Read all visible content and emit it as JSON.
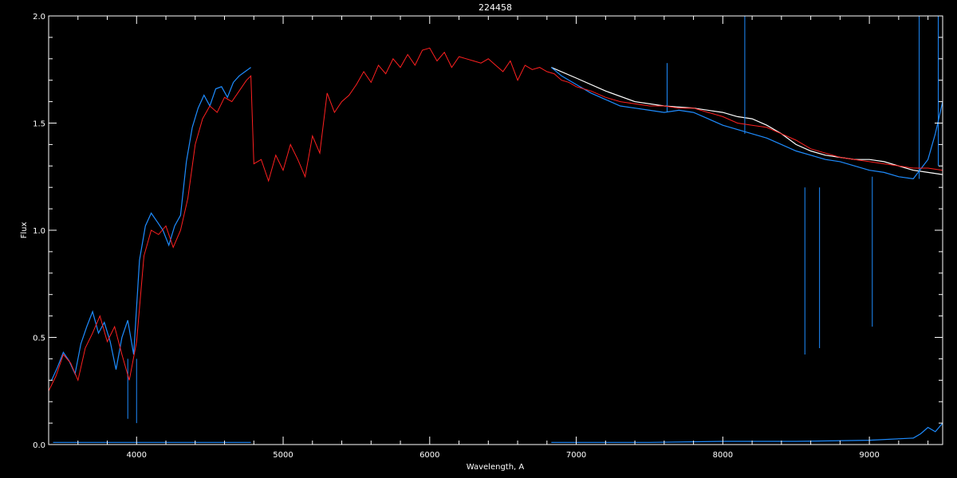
{
  "chart_data": {
    "type": "line",
    "title": "224458",
    "xlabel": "Wavelength, A",
    "ylabel": "Flux",
    "xlim": [
      3400,
      9500
    ],
    "ylim": [
      0.0,
      2.0
    ],
    "x_ticks": [
      4000,
      5000,
      6000,
      7000,
      8000,
      9000
    ],
    "x_tick_labels": [
      "4000",
      "5000",
      "6000",
      "7000",
      "8000",
      "9000"
    ],
    "y_ticks": [
      0.0,
      0.5,
      1.0,
      1.5,
      2.0
    ],
    "y_tick_labels": [
      "0.0",
      "0.5",
      "1.0",
      "1.5",
      "2.0"
    ],
    "grid": false,
    "colors": {
      "background": "#000000",
      "axes": "#ffffff",
      "observed_blue": "#1e8cff",
      "observed_white": "#ffffff",
      "template": "#ff2020",
      "error": "#1e8cff"
    },
    "series": [
      {
        "color": "#ffffff",
        "segments": [
          {
            "x": [
              6830,
              7000,
              7200,
              7400,
              7600,
              7800,
              8000,
              8100,
              8200,
              8300,
              8400,
              8500,
              8600,
              8700,
              8800,
              8900,
              9000,
              9100,
              9200,
              9300,
              9400,
              9500
            ],
            "y": [
              1.76,
              1.71,
              1.65,
              1.6,
              1.58,
              1.57,
              1.55,
              1.53,
              1.52,
              1.49,
              1.45,
              1.4,
              1.37,
              1.35,
              1.34,
              1.33,
              1.33,
              1.32,
              1.3,
              1.28,
              1.27,
              1.26
            ]
          }
        ]
      },
      {
        "color": "#1e8cff",
        "segments": [
          {
            "x": [
              3420,
              3460,
              3500,
              3540,
              3580,
              3620,
              3660,
              3700,
              3740,
              3780,
              3820,
              3860,
              3900,
              3940,
              3980,
              4020,
              4060,
              4100,
              4140,
              4180,
              4220,
              4260,
              4300,
              4340,
              4380,
              4420,
              4460,
              4500,
              4540,
              4580,
              4620,
              4660,
              4700,
              4740,
              4780
            ],
            "y": [
              0.3,
              0.36,
              0.43,
              0.39,
              0.33,
              0.47,
              0.55,
              0.62,
              0.52,
              0.57,
              0.48,
              0.35,
              0.5,
              0.58,
              0.42,
              0.86,
              1.02,
              1.08,
              1.04,
              1.0,
              0.93,
              1.02,
              1.07,
              1.32,
              1.48,
              1.57,
              1.63,
              1.58,
              1.66,
              1.67,
              1.62,
              1.69,
              1.72,
              1.74,
              1.76
            ]
          },
          {
            "x": [
              6830,
              6900,
              7000,
              7100,
              7200,
              7300,
              7400,
              7500,
              7600,
              7700,
              7800,
              7900,
              8000,
              8100,
              8200,
              8300,
              8400,
              8500,
              8600,
              8700,
              8800,
              8900,
              9000,
              9100,
              9200,
              9300,
              9400,
              9450,
              9500
            ],
            "y": [
              1.76,
              1.72,
              1.68,
              1.64,
              1.61,
              1.58,
              1.57,
              1.56,
              1.55,
              1.56,
              1.55,
              1.52,
              1.49,
              1.47,
              1.45,
              1.43,
              1.4,
              1.37,
              1.35,
              1.33,
              1.32,
              1.3,
              1.28,
              1.27,
              1.25,
              1.24,
              1.33,
              1.45,
              1.6
            ]
          }
        ],
        "spikes": [
          {
            "x": 8150,
            "y0": 1.45,
            "y1": 2.0
          },
          {
            "x": 8560,
            "y0": 1.2,
            "y1": 0.42
          },
          {
            "x": 8660,
            "y0": 1.2,
            "y1": 0.45
          },
          {
            "x": 9020,
            "y0": 1.25,
            "y1": 0.55
          },
          {
            "x": 7620,
            "y0": 1.55,
            "y1": 1.78
          },
          {
            "x": 9340,
            "y0": 1.24,
            "y1": 2.0
          },
          {
            "x": 9470,
            "y0": 1.3,
            "y1": 2.0
          },
          {
            "x": 4000,
            "y0": 0.4,
            "y1": 0.1
          },
          {
            "x": 3940,
            "y0": 0.4,
            "y1": 0.12
          }
        ]
      },
      {
        "color": "#ff2020",
        "segments": [
          {
            "x": [
              3400,
              3450,
              3500,
              3550,
              3600,
              3650,
              3700,
              3750,
              3800,
              3850,
              3900,
              3950,
              4000,
              4050,
              4100,
              4150,
              4200,
              4250,
              4300,
              4350,
              4400,
              4450,
              4500,
              4550,
              4600,
              4650,
              4700,
              4750,
              4780,
              4800,
              4850,
              4900,
              4950,
              5000,
              5050,
              5100,
              5150,
              5200,
              5250,
              5300,
              5350,
              5400,
              5450,
              5500,
              5550,
              5600,
              5650,
              5700,
              5750,
              5800,
              5850,
              5900,
              5950,
              6000,
              6050,
              6100,
              6150,
              6200,
              6250,
              6300,
              6350,
              6400,
              6450,
              6500,
              6550,
              6600,
              6650,
              6700,
              6750,
              6800,
              6850,
              6900,
              6950,
              7000,
              7100,
              7200,
              7300,
              7400,
              7500,
              7600,
              7700,
              7800,
              7900,
              8000,
              8100,
              8200,
              8300,
              8400,
              8500,
              8600,
              8700,
              8800,
              8900,
              9000,
              9100,
              9200,
              9300,
              9400,
              9500
            ],
            "y": [
              0.25,
              0.32,
              0.42,
              0.38,
              0.3,
              0.45,
              0.52,
              0.6,
              0.48,
              0.55,
              0.42,
              0.3,
              0.48,
              0.88,
              1.0,
              0.98,
              1.02,
              0.92,
              1.0,
              1.15,
              1.4,
              1.52,
              1.58,
              1.55,
              1.62,
              1.6,
              1.65,
              1.7,
              1.72,
              1.31,
              1.33,
              1.23,
              1.35,
              1.28,
              1.4,
              1.33,
              1.25,
              1.44,
              1.36,
              1.64,
              1.55,
              1.6,
              1.63,
              1.68,
              1.74,
              1.69,
              1.77,
              1.73,
              1.8,
              1.76,
              1.82,
              1.77,
              1.84,
              1.85,
              1.79,
              1.83,
              1.76,
              1.81,
              1.8,
              1.79,
              1.78,
              1.8,
              1.77,
              1.74,
              1.79,
              1.7,
              1.77,
              1.75,
              1.76,
              1.74,
              1.73,
              1.7,
              1.69,
              1.67,
              1.65,
              1.62,
              1.6,
              1.59,
              1.58,
              1.58,
              1.57,
              1.57,
              1.55,
              1.53,
              1.5,
              1.49,
              1.48,
              1.45,
              1.42,
              1.38,
              1.36,
              1.34,
              1.33,
              1.32,
              1.31,
              1.3,
              1.29,
              1.29,
              1.28
            ]
          }
        ]
      },
      {
        "color": "#1e8cff",
        "segments": [
          {
            "x": [
              3430,
              4000,
              4780
            ],
            "y": [
              0.01,
              0.01,
              0.01
            ]
          },
          {
            "x": [
              6830,
              7500,
              8000,
              8500,
              9000,
              9300,
              9350,
              9400,
              9450,
              9500
            ],
            "y": [
              0.01,
              0.01,
              0.015,
              0.015,
              0.02,
              0.03,
              0.05,
              0.08,
              0.06,
              0.1
            ]
          }
        ]
      }
    ]
  }
}
